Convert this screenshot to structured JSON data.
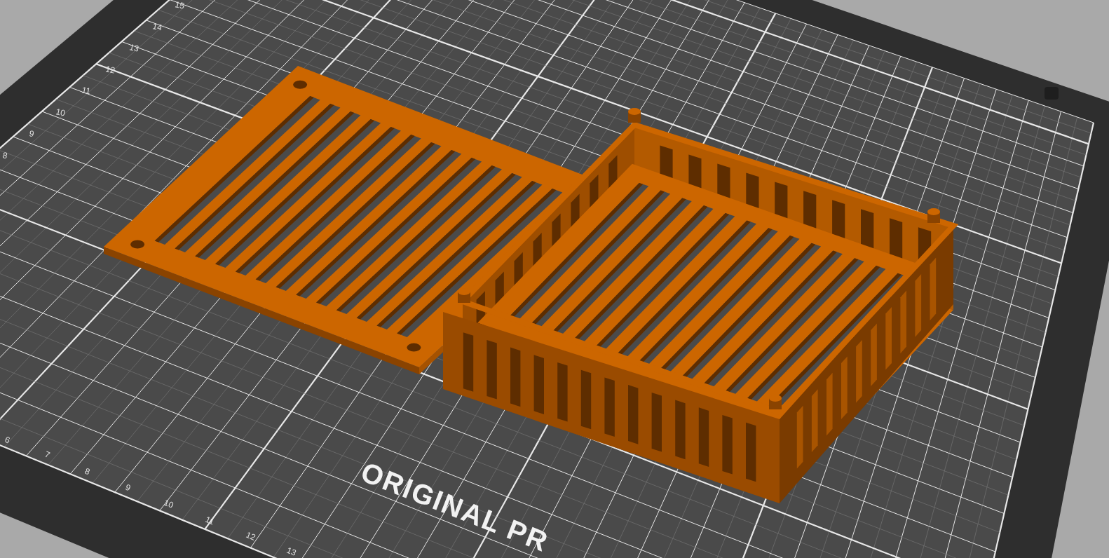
{
  "bed": {
    "logo_text": "ORIGINAL PR",
    "y_axis_labels": [
      "15",
      "14",
      "13",
      "12",
      "11",
      "10",
      "9",
      "8"
    ],
    "x_axis_labels": [
      "6",
      "7",
      "8",
      "9",
      "10",
      "11",
      "12",
      "13"
    ]
  }
}
